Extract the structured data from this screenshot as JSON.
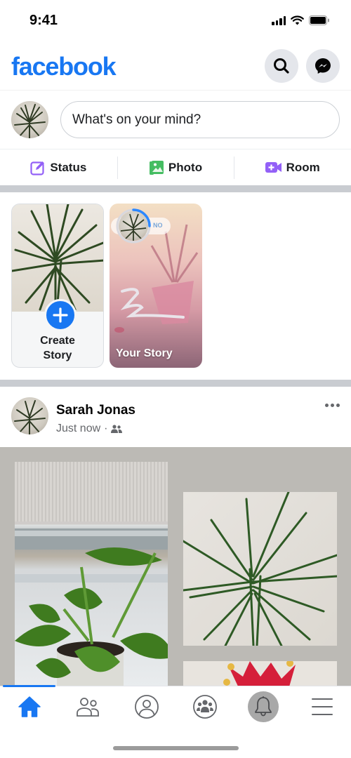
{
  "status_bar": {
    "time": "9:41"
  },
  "header": {
    "logo": "facebook",
    "brand_color": "#1877f2",
    "buttons": [
      {
        "name": "search",
        "icon": "search-icon"
      },
      {
        "name": "messenger",
        "icon": "messenger-icon"
      }
    ]
  },
  "composer": {
    "placeholder": "What's on your mind?",
    "actions": [
      {
        "label": "Status",
        "icon": "edit-icon",
        "color": "#9360f7"
      },
      {
        "label": "Photo",
        "icon": "photo-icon",
        "color": "#45bd62"
      },
      {
        "label": "Room",
        "icon": "video-room-icon",
        "color": "#9360f7"
      }
    ]
  },
  "stories": {
    "create": {
      "label_line1": "Create",
      "label_line2": "Story"
    },
    "yours": {
      "label": "Your Story",
      "sticker_text": "NO"
    }
  },
  "post": {
    "author": "Sarah Jonas",
    "time": "Just now",
    "separator": "·",
    "audience_icon": "friends-icon"
  },
  "tabbar": {
    "active": "home",
    "tabs": [
      {
        "name": "home",
        "icon": "home-icon"
      },
      {
        "name": "friends",
        "icon": "friends-icon"
      },
      {
        "name": "profile",
        "icon": "profile-icon"
      },
      {
        "name": "groups",
        "icon": "groups-icon"
      },
      {
        "name": "notifications",
        "icon": "bell-icon"
      },
      {
        "name": "menu",
        "icon": "menu-icon"
      }
    ]
  }
}
